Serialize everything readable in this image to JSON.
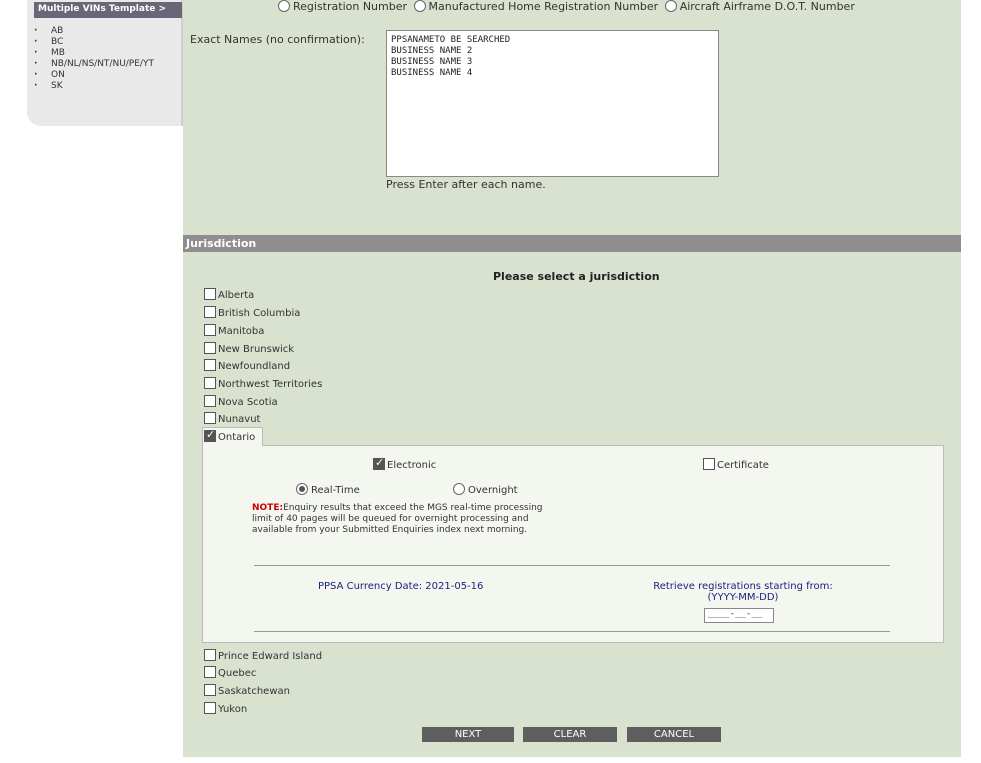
{
  "sidebar": {
    "title": "Multiple VINs Template >",
    "items": [
      "AB",
      "BC",
      "MB",
      "NB/NL/NS/NT/NU/PE/YT",
      "ON",
      "SK"
    ]
  },
  "search_types": [
    {
      "label": "Registration Number",
      "selected": false
    },
    {
      "label": "Manufactured Home Registration Number",
      "selected": false
    },
    {
      "label": "Aircraft Airframe D.O.T. Number",
      "selected": false
    }
  ],
  "names": {
    "label": "Exact Names (no confirmation):",
    "value": "PPSANAMETO BE SEARCHED\nBUSINESS NAME 2\nBUSINESS NAME 3\nBUSINESS NAME 4",
    "hint": "Press Enter after each name."
  },
  "jurisdiction": {
    "section_title": "Jurisdiction",
    "prompt": "Please select a jurisdiction",
    "items_top": [
      "Alberta",
      "British Columbia",
      "Manitoba",
      "New Brunswick",
      "Newfoundland",
      "Northwest Territories",
      "Nova Scotia",
      "Nunavut"
    ],
    "selected": "Ontario",
    "items_bottom": [
      "Prince Edward Island",
      "Quebec",
      "Saskatchewan",
      "Yukon"
    ]
  },
  "ontario": {
    "electronic_label": "Electronic",
    "electronic_checked": true,
    "certificate_label": "Certificate",
    "certificate_checked": false,
    "realtime_label": "Real-Time",
    "overnight_label": "Overnight",
    "note_prefix": "NOTE:",
    "note_text": "Enquiry results that exceed the MGS real-time processing limit of 40 pages will be queued for overnight processing and available from your Submitted Enquiries index next morning.",
    "currency_date": "PPSA Currency Date: 2021-05-16",
    "retrieve_label": "Retrieve registrations starting from:",
    "retrieve_format": "(YYYY-MM-DD)",
    "date_value": "____-__-__"
  },
  "buttons": {
    "next": "NEXT",
    "clear": "CLEAR",
    "cancel": "CANCEL"
  }
}
